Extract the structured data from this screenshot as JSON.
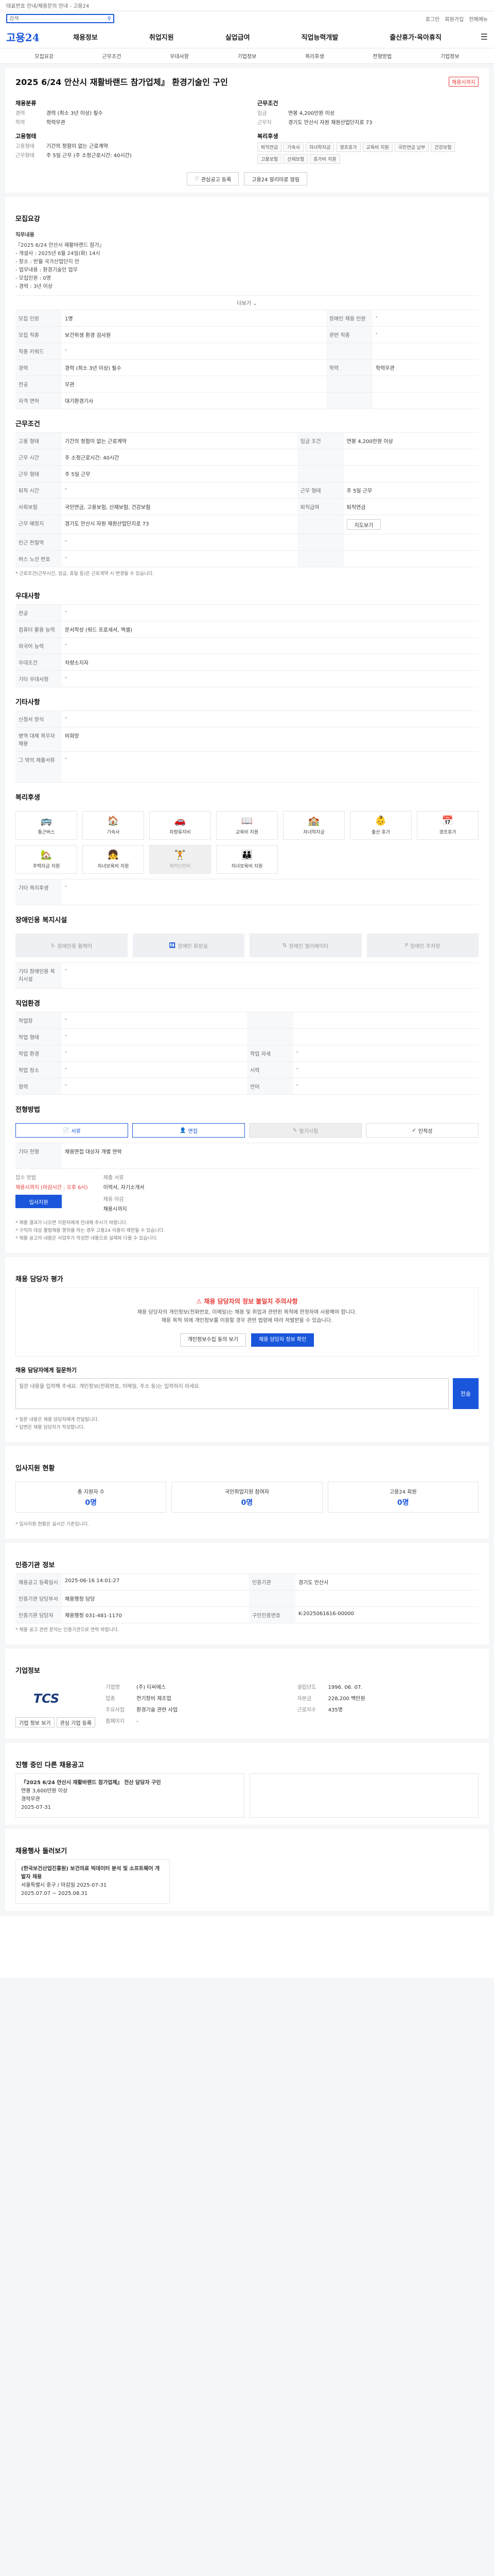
{
  "topbar": {
    "notice": "대표번호 안내/채용문의 안내 - 고용24"
  },
  "search": {
    "placeholder": "검색",
    "util": [
      "로그인",
      "회원가입",
      "전체메뉴"
    ]
  },
  "header": {
    "logo": "고용24",
    "gnb": [
      "채용정보",
      "취업지원",
      "실업급여",
      "직업능력개발",
      "출산휴가·육아휴직"
    ]
  },
  "subnav": [
    "모집요강",
    "근무조건",
    "우대사항",
    "기업정보",
    "복리후생",
    "전형방법",
    "기업정보"
  ],
  "job": {
    "title": "2025 6/24 안산시 재활바랜드 참가업체』 환경기술인 구인",
    "badge": "채용시까지",
    "left_title": "채용분류",
    "left": [
      {
        "k": "경력",
        "v": "경력 (최소 3년 이상) 필수"
      },
      {
        "k": "학력",
        "v": "학력무관"
      }
    ],
    "left2_title": "고용형태",
    "left2": [
      {
        "k": "고용형태",
        "v": "기간의 정함이 없는 근로계약"
      },
      {
        "k": "근무형태",
        "v": "주 5일 근무 (주 소정근로시간: 40시간)"
      }
    ],
    "right_title": "근무조건",
    "right": [
      {
        "k": "임금",
        "v": "연봉 4,200만원 이상"
      },
      {
        "k": "근무지",
        "v": "경기도 안산시 자원 재원산업단지로 73"
      }
    ],
    "right2_title": "복리후생",
    "tags": [
      "퇴직연금",
      "기숙사",
      "자녀학자금",
      "경조휴가",
      "교육비 지원",
      "국민연금 납부",
      "건강보험",
      "고용보험",
      "산재보험",
      "휴가비 지원"
    ],
    "btn_save": "관심공고 등록",
    "btn_share": "고용24 알리미로 알림"
  },
  "recruit": {
    "title": "모집요강",
    "duty_title": "직무내용",
    "duty_lines": [
      "『2025 6/24 안산시 재활바랜드 참가』",
      "- 개설사 : 2025년 6월 24일(화) 14시",
      "- 장소 : 반월 국가산업단지 안",
      "- 업무내용 : 환경기술인 업무",
      "- 모집인원 : 0명",
      "- 경력 : 3년 이상"
    ],
    "more": "더보기",
    "rows": [
      {
        "k": "모집 인원",
        "v": "1명",
        "k2": "장애인 채용 인원",
        "v2": "-"
      },
      {
        "k": "모집 직종",
        "v": "보건위생 환경 검사원",
        "k2": "관련 직종",
        "v2": "-"
      },
      {
        "k": "직종 키워드",
        "v": "-",
        "k2": "",
        "v2": ""
      },
      {
        "k": "경력",
        "v": "경력 (최소 3년 이상) 필수",
        "k2": "학력",
        "v2": "학력무관"
      },
      {
        "k": "전공",
        "v": "무관",
        "k2": "",
        "v2": ""
      },
      {
        "k": "자격 면허",
        "v": "대기환경기사",
        "k2": "",
        "v2": ""
      }
    ]
  },
  "work": {
    "title": "근무조건",
    "rows": [
      {
        "k": "고용 형태",
        "v": "기간의 정함이 없는 근로계약",
        "k2": "임금 조건",
        "v2": "연봉 4,200만원 이상"
      },
      {
        "k": "근무 시간",
        "v": "주 소정근로시간: 40시간",
        "k2": "",
        "v2": ""
      },
      {
        "k": "근무 형태",
        "v": "주 5일 근무",
        "k2": "",
        "v2": ""
      },
      {
        "k": "퇴직 시간",
        "v": "-",
        "k2": "근무 형태",
        "v2": "주 5일 근무"
      },
      {
        "k": "사회보험",
        "v": "국민연금, 고용보험, 산재보험, 건강보험",
        "k2": "퇴직급여",
        "v2": "퇴직연금"
      },
      {
        "k": "근무 예정지",
        "v": "경기도 안산시 자원 재원산업단지로 73",
        "k2": "",
        "v2": ""
      },
      {
        "k": "인근 전철역",
        "v": "-",
        "k2": "",
        "v2": ""
      },
      {
        "k": "버스 노선 번호",
        "v": "-",
        "k2": "",
        "v2": ""
      }
    ],
    "map_btn": "지도보기",
    "note": "* 근로조건(근무시간, 임금, 휴일 등)은 근로계약 시 변경될 수 있습니다."
  },
  "pref": {
    "title": "우대사항",
    "rows": [
      {
        "k": "전공",
        "v": "-"
      },
      {
        "k": "컴퓨터 활용 능력",
        "v": "문서작성 (워드 프로세서, 엑셀)"
      },
      {
        "k": "외국어 능력",
        "v": "-"
      },
      {
        "k": "우대조건",
        "v": "차량소지자"
      },
      {
        "k": "기타 우대사항",
        "v": "-"
      }
    ]
  },
  "etc": {
    "title": "기타사항",
    "rows": [
      {
        "k": "신청서 양식",
        "v": "-"
      },
      {
        "k": "병역 대체 복무자 채용",
        "v": "비희망"
      },
      {
        "k": "그 밖의 제출서류",
        "v": "-"
      }
    ]
  },
  "welfare": {
    "title": "복리후생",
    "items": [
      "통근버스",
      "기숙사",
      "차량유지비",
      "교육비 지원",
      "자녀학자금",
      "출산 휴가",
      "경조휴가",
      "주택자금 지원",
      "자녀보육비 지원",
      "체력단련비",
      "자녀보육비 지원"
    ],
    "etc_label": "기타 복리후생",
    "etc_value": "-"
  },
  "disability": {
    "title": "장애인용 복지시설",
    "items": [
      "장애인용 휠체어",
      "장애인 화장실",
      "장애인 엘리베이터",
      "장애인 주차장"
    ],
    "etc_label": "기타 장애인용 복지시설",
    "etc_value": "-"
  },
  "company_detail": {
    "title": "직업환경",
    "rows": [
      {
        "k": "작업장",
        "v": "-",
        "k2": "",
        "v2": ""
      },
      {
        "k": "작업 형태",
        "v": "-",
        "k2": "",
        "v2": ""
      },
      {
        "k": "작업 환경",
        "v": "-",
        "k2": "작업 자세",
        "v2": "-"
      },
      {
        "k": "작업 장소",
        "v": "-",
        "k2": "시력",
        "v2": "-"
      },
      {
        "k": "청력",
        "v": "-",
        "k2": "언어",
        "v2": "-"
      }
    ]
  },
  "selection": {
    "title": "전형방법",
    "methods": [
      "서류",
      "면접",
      "필기시험",
      "인적성"
    ],
    "etc_label": "기타 전형",
    "etc_value": "채용면접 대상자 개별 연락",
    "apply_title": "접수 방법",
    "apply_way": "채용시까지 (마감시간 : 오후 6시)",
    "docs_title": "제출 서류",
    "docs": "이력서, 자기소개서",
    "btn_apply": "입사지원",
    "contact_title": "채용 마감",
    "contact": "채용시까지",
    "notices": [
      "* 채용 결과가 나오면 지원자에게 안내해 주시기 바랍니다.",
      "* 구직자 대상 불법채용 행위를 하는 경우 고용24 이용이 제한될 수 있습니다.",
      "* 채용 공고의 내용은 사업주가 작성한 내용으로 실제와 다를 수 있습니다."
    ]
  },
  "warning": {
    "title": "채용 담당자 평가",
    "head": "채용 담당자의 정보 불일치 주의사항",
    "lines": [
      "채용 담당자의 개인정보(전화번호, 이메일)는 채용 및 취업과 관련된 목적에 한정하여 사용해야 합니다.",
      "채용 목적 외에 개인정보를 이용할 경우 관련 법령에 따라 처벌받을 수 있습니다."
    ],
    "btn1": "개인정보수집 동의 보기",
    "btn2": "채용 담당자 정보 확인"
  },
  "comment": {
    "title": "채용 담당자에게 질문하기",
    "placeholder": "질문 내용을 입력해 주세요. 개인정보(전화번호, 이메일, 주소 등)는 입력하지 마세요.",
    "send": "전송",
    "notes": [
      "* 질문 내용은 채용 담당자에게 전달됩니다.",
      "* 답변은 채용 담당자가 작성합니다."
    ]
  },
  "status": {
    "title": "입사지원 현황",
    "total_label": "총 지원자 수",
    "total_value": "0명",
    "stat1_label": "국민취업지원 참여자",
    "stat1_value": "0명",
    "stat2_label": "고용24 회원",
    "stat2_value": "0명",
    "note": "* 입사지원 현황은 실시간 기준입니다."
  },
  "manage": {
    "title": "인증기관 정보",
    "rows": [
      {
        "k": "채용공고 등록일시",
        "v": "2025-06-16 14:01:27",
        "k2": "인증기관",
        "v2": "경기도 안산시"
      },
      {
        "k": "인증기관 담당부서",
        "v": "채용행정 담당",
        "k2": "",
        "v2": ""
      },
      {
        "k": "인증기관 담당자",
        "v": "채용행정 031-481-1170",
        "k2": "구인인증번호",
        "v2": "K-2025061616-00000"
      }
    ],
    "notice": "* 채용 공고 관련 문의는 인증기관으로 연락 바랍니다."
  },
  "company": {
    "title": "기업정보",
    "logo": "TCS",
    "rows": [
      {
        "k": "기업명",
        "v": "(주) 티씨에스",
        "k2": "설립년도",
        "v2": "1996. 06. 07."
      },
      {
        "k": "업종",
        "v": "전기장비 제조업",
        "k2": "자본금",
        "v2": "228,200 백만원"
      },
      {
        "k": "주요사업",
        "v": "환경기술 관련 사업",
        "k2": "근로자수",
        "v2": "435명"
      },
      {
        "k": "홈페이지",
        "v": "-",
        "k2": "",
        "v2": ""
      }
    ],
    "btn1": "기업 정보 보기",
    "btn2": "관심 기업 등록"
  },
  "similar": {
    "title": "진행 중인 다른 채용공고",
    "items": [
      {
        "title": "『2025 6/24 안산시 재활바랜드 참가업체』 전산 담당자 구인",
        "wage": "연봉 3,600만원 이상",
        "career": "경력무관",
        "date": "2025-07-31"
      },
      {
        "title": "",
        "wage": "",
        "career": "",
        "date": ""
      }
    ]
  },
  "recent": {
    "title": "채용행사 둘러보기",
    "item_title": "(한국보건산업진흥원) 보건의료 빅데이터 분석 및 소프트웨어 개발자 채용",
    "item_sub": "서울특별시 중구 / 마감일 2025-07-31",
    "item_date": "2025.07.07 ~ 2025.08.31"
  }
}
